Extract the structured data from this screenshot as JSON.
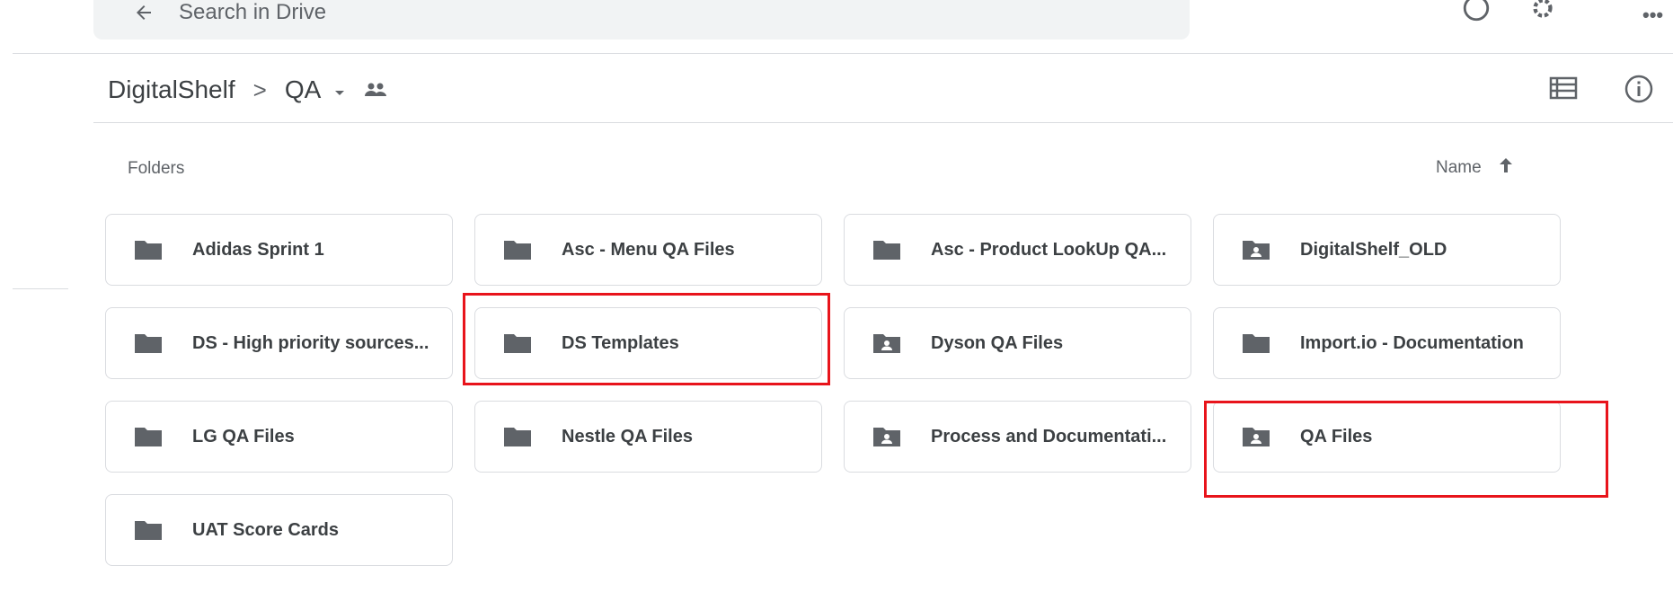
{
  "search": {
    "placeholder": "Search in Drive"
  },
  "breadcrumb": {
    "root": "DigitalShelf",
    "separator": ">",
    "current": "QA"
  },
  "section": {
    "label": "Folders"
  },
  "sort": {
    "label": "Name"
  },
  "folders": [
    {
      "name": "Adidas Sprint 1",
      "shared": false
    },
    {
      "name": "Asc - Menu QA Files",
      "shared": false
    },
    {
      "name": "Asc - Product LookUp QA...",
      "shared": false
    },
    {
      "name": "DigitalShelf_OLD",
      "shared": true
    },
    {
      "name": "DS - High priority sources...",
      "shared": false
    },
    {
      "name": "DS Templates",
      "shared": false
    },
    {
      "name": "Dyson QA Files",
      "shared": true
    },
    {
      "name": "Import.io - Documentation",
      "shared": false
    },
    {
      "name": "LG QA Files",
      "shared": false
    },
    {
      "name": "Nestle QA Files",
      "shared": false
    },
    {
      "name": "Process and Documentati...",
      "shared": true
    },
    {
      "name": "QA Files",
      "shared": true
    },
    {
      "name": "UAT Score Cards",
      "shared": false
    }
  ],
  "highlighted": [
    "DS Templates",
    "QA Files"
  ],
  "colors": {
    "folder_icon": "#5f6368",
    "highlight": "#e8141b",
    "text": "#3c4043"
  }
}
